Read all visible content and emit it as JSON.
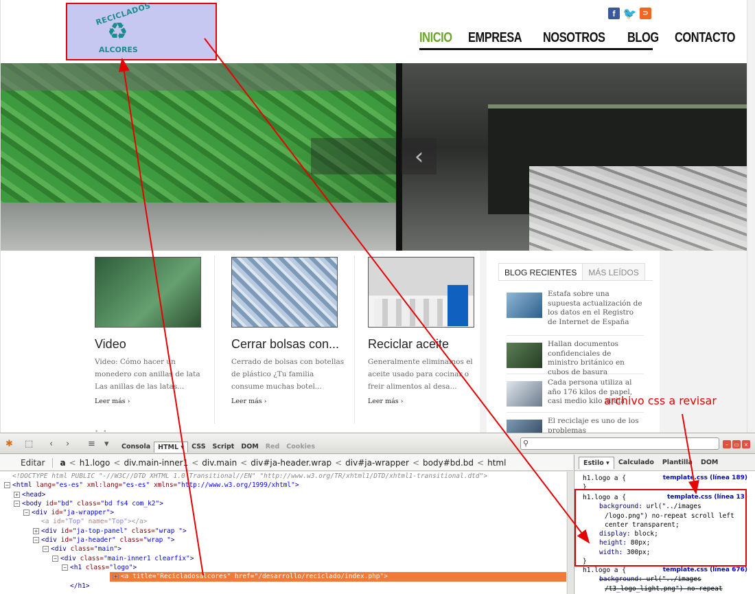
{
  "site": {
    "logo": {
      "arc_text": "RECICLADOS",
      "bottom_text": "ALCORES"
    },
    "social": {
      "facebook_glyph": "f",
      "twitter_glyph": "🐦",
      "rss_glyph": "⊃"
    },
    "nav": [
      "INICIO",
      "EMPRESA",
      "NOSOTROS",
      "BLOG",
      "CONTACTO"
    ],
    "slider": {
      "prev_arrow": "‹"
    },
    "articles": [
      {
        "title": "Video",
        "excerpt": "Video: Cómo hacer un monedero con anillas de lata Las anillas de las latas...",
        "more": "Leer más ›"
      },
      {
        "title": "Cerrar bolsas con...",
        "excerpt": "Cerrado de bolsas con botellas de plástico ¿Tu familia consume muchas botel...",
        "more": "Leer más ›"
      },
      {
        "title": "Reciclar aceite",
        "excerpt": "Generalmente eliminamos el aceite usado para cocinar o freir alimentos al desa...",
        "more": "Leer más ›"
      }
    ],
    "sidebar": {
      "tabs": [
        "BLOG RECIENTES",
        "MÁS LEÍDOS"
      ],
      "posts": [
        "Estafa sobre una supuesta actualización de los datos en el Registro de Internet de España",
        "Hallan documentos confidenciales de ministro británico en cubos de basura",
        "Cada persona utiliza al año 176 kilos de papel, casi medio kilo al día",
        "El reciclaje es uno de los problemas medioambientales"
      ]
    }
  },
  "annotation": {
    "label": "archivo css a revisar",
    "color": "#e60000"
  },
  "firebug": {
    "tabs": [
      "Consola",
      "HTML ▾",
      "CSS",
      "Script",
      "DOM",
      "Red",
      "Cookies"
    ],
    "active_tab": "HTML ▾",
    "search_placeholder": "",
    "breadcrumb": {
      "edit": "Editar",
      "items": [
        "a",
        "h1.logo",
        "div.main-inner1",
        "div.main",
        "div#ja-header.wrap",
        "div#ja-wrapper",
        "body#bd.bd",
        "html"
      ]
    },
    "tree": [
      {
        "indent": 0,
        "toggle": "",
        "type": "doctype",
        "text": "<!DOCTYPE html PUBLIC \"-//W3C//DTD XHTML 1.0 Transitional//EN\" \"http://www.w3.org/TR/xhtml1/DTD/xhtml1-transitional.dtd\">"
      },
      {
        "indent": 0,
        "toggle": "−",
        "type": "tag",
        "tag": "html",
        "attrs": [
          [
            "lang",
            "es-es"
          ],
          [
            "xml:lang",
            "es-es"
          ],
          [
            "xmlns",
            "http://www.w3.org/1999/xhtml"
          ]
        ],
        "close": ">"
      },
      {
        "indent": 1,
        "toggle": "+",
        "type": "tag",
        "tag": "head",
        "attrs": [],
        "close": ">"
      },
      {
        "indent": 1,
        "toggle": "−",
        "type": "tag",
        "tag": "body",
        "attrs": [
          [
            "id",
            "bd"
          ],
          [
            "class",
            "bd fs4 com_k2"
          ]
        ],
        "close": ">"
      },
      {
        "indent": 2,
        "toggle": "−",
        "type": "tag",
        "tag": "div",
        "attrs": [
          [
            "id",
            "ja-wrapper"
          ]
        ],
        "close": ">"
      },
      {
        "indent": 3,
        "toggle": "",
        "type": "tag",
        "tag": "a",
        "attrs": [
          [
            "id",
            "Top"
          ],
          [
            "name",
            "Top"
          ]
        ],
        "close": "></a>",
        "faded": true
      },
      {
        "indent": 3,
        "toggle": "+",
        "type": "tag",
        "tag": "div",
        "attrs": [
          [
            "id",
            "ja-top-panel"
          ],
          [
            "class",
            "wrap "
          ]
        ],
        "close": ">"
      },
      {
        "indent": 3,
        "toggle": "−",
        "type": "tag",
        "tag": "div",
        "attrs": [
          [
            "id",
            "ja-header"
          ],
          [
            "class",
            "wrap "
          ]
        ],
        "close": ">"
      },
      {
        "indent": 4,
        "toggle": "−",
        "type": "tag",
        "tag": "div",
        "attrs": [
          [
            "class",
            "main"
          ]
        ],
        "close": ">"
      },
      {
        "indent": 5,
        "toggle": "−",
        "type": "tag",
        "tag": "div",
        "attrs": [
          [
            "class",
            "main-inner1 clearfix"
          ]
        ],
        "close": ">"
      },
      {
        "indent": 6,
        "toggle": "−",
        "type": "tag",
        "tag": "h1",
        "attrs": [
          [
            "class",
            "logo"
          ]
        ],
        "close": ">"
      },
      {
        "indent": 7,
        "toggle": "+",
        "type": "tag",
        "tag": "a",
        "attrs": [
          [
            "title",
            "Recicladosalcores"
          ],
          [
            "href",
            "/desarrollo/reciclado/index.php"
          ]
        ],
        "close": ">",
        "selected": true
      },
      {
        "indent": 6,
        "toggle": "",
        "type": "close",
        "text": "</h1>"
      }
    ],
    "style_tabs": [
      "Estilo ▾",
      "Calculado",
      "Plantilla",
      "DOM"
    ],
    "rules": [
      {
        "selector": "h1.logo a {",
        "source": "template.css (línea 189)",
        "decls": [],
        "end": "}"
      },
      {
        "selector": "h1.logo a {",
        "source": "template.css (línea 13)",
        "decls": [
          [
            "background",
            "url(\"../images",
            "/logo.png\") no-repeat scroll left",
            "center transparent;"
          ],
          [
            "display",
            "block;"
          ],
          [
            "height",
            "80px;"
          ],
          [
            "width",
            "300px;"
          ]
        ],
        "end": "}"
      },
      {
        "selector": "h1.logo a {",
        "source": "template.css (línea 676)",
        "decls": [
          [
            "background",
            "url(\"../images",
            "/t3_logo_light.png\") no-repeat"
          ]
        ],
        "end": "",
        "struck": true
      }
    ]
  }
}
